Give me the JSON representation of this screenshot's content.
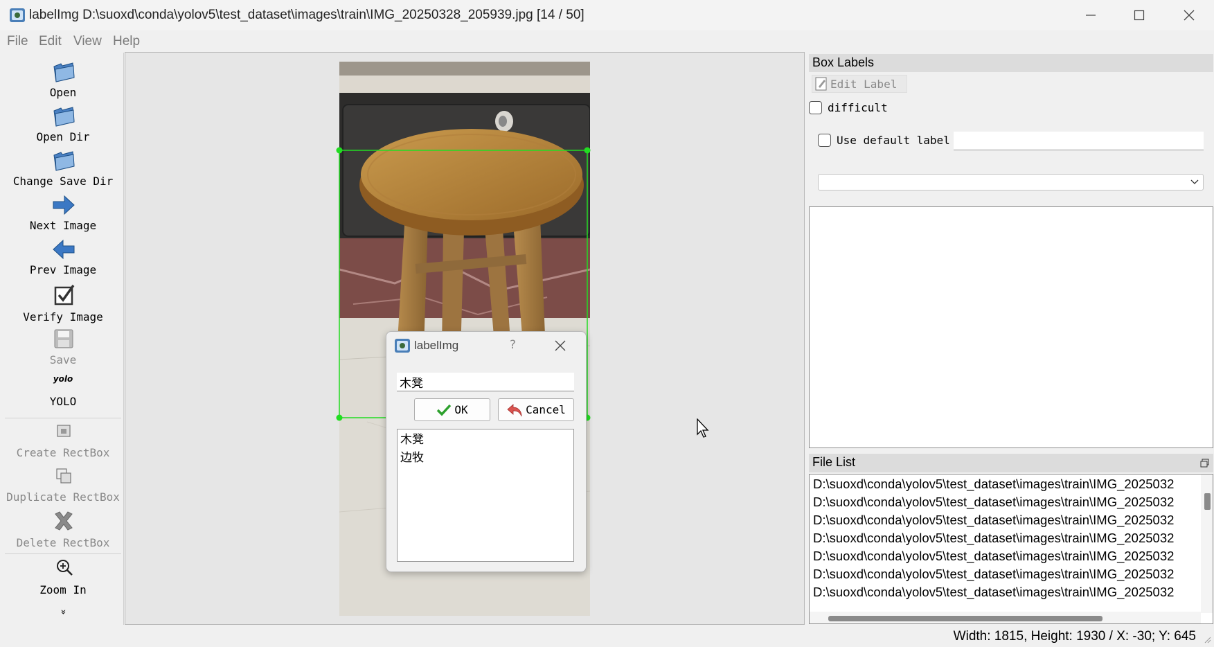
{
  "window": {
    "title": "labelImg D:\\suoxd\\conda\\yolov5\\test_dataset\\images\\train\\IMG_20250328_205939.jpg [14 / 50]"
  },
  "menu": [
    "File",
    "Edit",
    "View",
    "Help"
  ],
  "toolbar": {
    "open": "Open",
    "open_dir": "Open Dir",
    "change_save_dir": "Change Save Dir",
    "next_image": "Next Image",
    "prev_image": "Prev Image",
    "verify_image": "Verify Image",
    "save": "Save",
    "format_icon_text": "yolo",
    "format": "YOLO",
    "create_rectbox": "Create RectBox",
    "duplicate_rectbox": "Duplicate RectBox",
    "delete_rectbox": "Delete RectBox",
    "zoom_in": "Zoom In",
    "more": "»"
  },
  "dialog": {
    "title": "labelImg",
    "help": "?",
    "input_value": "木凳",
    "ok": "OK",
    "cancel": "Cancel",
    "labels": [
      "木凳",
      "边牧"
    ]
  },
  "box_labels": {
    "title": "Box Labels",
    "edit_label": "Edit Label",
    "difficult": "difficult",
    "use_default_label": "Use default label",
    "default_label_value": ""
  },
  "file_list": {
    "title": "File List",
    "items": [
      "D:\\suoxd\\conda\\yolov5\\test_dataset\\images\\train\\IMG_2025032",
      "D:\\suoxd\\conda\\yolov5\\test_dataset\\images\\train\\IMG_2025032",
      "D:\\suoxd\\conda\\yolov5\\test_dataset\\images\\train\\IMG_2025032",
      "D:\\suoxd\\conda\\yolov5\\test_dataset\\images\\train\\IMG_2025032",
      "D:\\suoxd\\conda\\yolov5\\test_dataset\\images\\train\\IMG_2025032",
      "D:\\suoxd\\conda\\yolov5\\test_dataset\\images\\train\\IMG_2025032",
      "D:\\suoxd\\conda\\yolov5\\test_dataset\\images\\train\\IMG_2025032"
    ]
  },
  "status": {
    "text": "Width: 1815, Height: 1930 / X: -30; Y: 645"
  },
  "colors": {
    "bbox": "#22dd22",
    "accent_blue": "#3b78c4"
  }
}
